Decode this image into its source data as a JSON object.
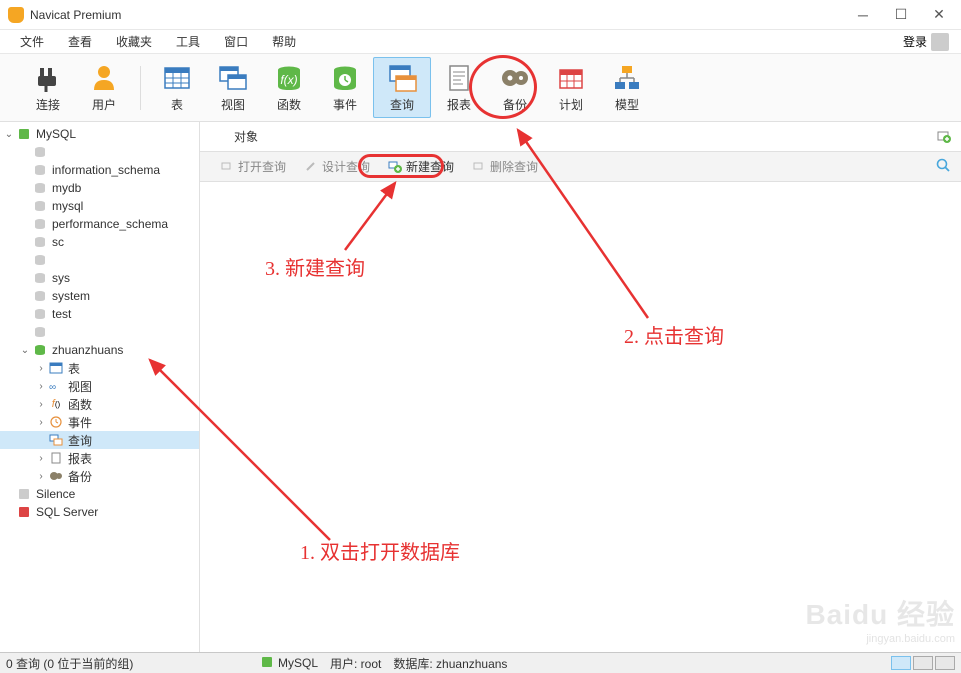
{
  "title": "Navicat Premium",
  "menu": [
    "文件",
    "查看",
    "收藏夹",
    "工具",
    "窗口",
    "帮助"
  ],
  "login_label": "登录",
  "toolbar": [
    {
      "label": "连接",
      "kind": "plug"
    },
    {
      "label": "用户",
      "kind": "user"
    },
    {
      "label": "表",
      "kind": "table"
    },
    {
      "label": "视图",
      "kind": "view"
    },
    {
      "label": "函数",
      "kind": "func"
    },
    {
      "label": "事件",
      "kind": "event"
    },
    {
      "label": "查询",
      "kind": "query",
      "active": true
    },
    {
      "label": "报表",
      "kind": "report"
    },
    {
      "label": "备份",
      "kind": "backup"
    },
    {
      "label": "计划",
      "kind": "schedule"
    },
    {
      "label": "模型",
      "kind": "model"
    }
  ],
  "tree": {
    "conn1": "MySQL",
    "dbs": [
      "",
      "information_schema",
      "mydb",
      "mysql",
      "performance_schema",
      "sc",
      "",
      "sys",
      "system",
      "test",
      ""
    ],
    "active_db": "zhuanzhuans",
    "nodes": [
      {
        "label": "表",
        "kind": "table"
      },
      {
        "label": "视图",
        "kind": "view"
      },
      {
        "label": "函数",
        "kind": "func"
      },
      {
        "label": "事件",
        "kind": "event"
      },
      {
        "label": "查询",
        "kind": "query",
        "selected": true
      },
      {
        "label": "报表",
        "kind": "report"
      },
      {
        "label": "备份",
        "kind": "backup"
      }
    ],
    "conn2": "Silence",
    "conn3": "SQL Server"
  },
  "tab_label": "对象",
  "actions": {
    "open": "打开查询",
    "design": "设计查询",
    "new": "新建查询",
    "delete": "删除查询"
  },
  "status": {
    "left": "0 查询 (0 位于当前的组)",
    "conn": "MySQL",
    "user_label": "用户: root",
    "db_label": "数据库: zhuanzhuans"
  },
  "annotations": {
    "a1": "1. 双击打开数据库",
    "a2": "2. 点击查询",
    "a3": "3. 新建查询"
  },
  "watermark": {
    "big": "Baidu 经验",
    "small": "jingyan.baidu.com"
  }
}
